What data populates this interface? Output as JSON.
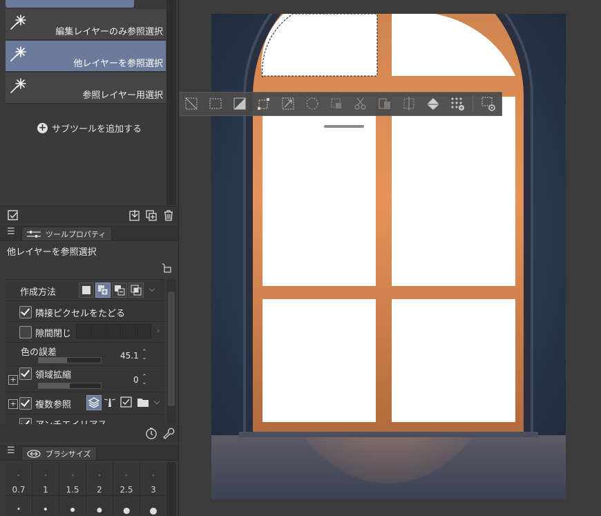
{
  "subtool_list": {
    "items": [
      {
        "label": "編集レイヤーのみ参照選択",
        "selected": false
      },
      {
        "label": "他レイヤーを参照選択",
        "selected": true
      },
      {
        "label": "参照レイヤー用選択",
        "selected": false
      }
    ],
    "add_subtool_label": "サブツールを追加する"
  },
  "tool_property": {
    "tab_label": "ツールプロパティ",
    "tool_name": "他レイヤーを参照選択",
    "rows": {
      "creation_method_label": "作成方法",
      "trace_adjacent_label": "隣接ピクセルをたどる",
      "close_gap_label": "隙間閉じ",
      "color_margin_label": "色の誤差",
      "color_margin_value": "45.1",
      "color_margin_fraction": 0.451,
      "area_scaling_label": "領域拡縮",
      "area_scaling_value": "0",
      "area_scaling_fraction": 0.5,
      "multi_ref_label": "複数参照",
      "antialias_label": "アンチエイリアス"
    },
    "checked": {
      "trace_adjacent": true,
      "close_gap": false,
      "area_scaling": true,
      "multi_ref": true
    }
  },
  "brush_size": {
    "tab_label": "ブラシサイズ",
    "sizes": [
      "0.7",
      "1",
      "1.5",
      "2",
      "2.5",
      "3"
    ]
  },
  "floating_toolbar": {
    "icons": [
      "deselect-icon",
      "select-all-icon",
      "invert-selection-icon",
      "transform-icon",
      "scale-icon",
      "expand-selection-icon",
      "shrink-selection-icon",
      "cut-icon",
      "copy-paste-icon",
      "crop-icon",
      "fill-icon",
      "screentone-icon",
      "settings-icon"
    ]
  },
  "colors": {
    "accent": "#6c7a9c",
    "panel": "#3a3a3a",
    "canvas_bg": "#3b3b3b",
    "window_glow": "#e08a4a",
    "wall": "#2b3a4d"
  }
}
